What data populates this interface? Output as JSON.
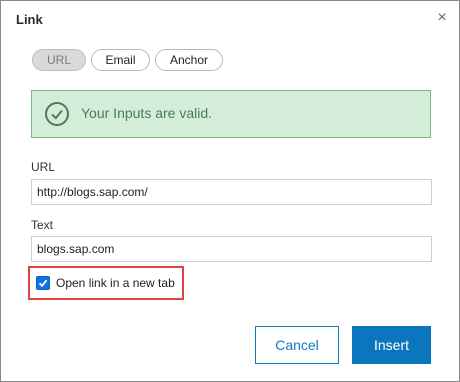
{
  "dialog": {
    "title": "Link",
    "close_symbol": "×"
  },
  "tabs": [
    {
      "label": "URL",
      "active": true
    },
    {
      "label": "Email",
      "active": false
    },
    {
      "label": "Anchor",
      "active": false
    }
  ],
  "alert": {
    "icon": "check-circle-icon",
    "message": "Your Inputs are valid.",
    "color": "#4a7c59"
  },
  "fields": {
    "url": {
      "label": "URL",
      "value": "http://blogs.sap.com/"
    },
    "text": {
      "label": "Text",
      "value": "blogs.sap.com"
    }
  },
  "new_tab": {
    "label": "Open link in a new tab",
    "checked": true
  },
  "buttons": {
    "cancel": "Cancel",
    "insert": "Insert"
  },
  "colors": {
    "primary": "#0b76be",
    "success_bg": "#d4edd9",
    "highlight": "#e04141"
  }
}
